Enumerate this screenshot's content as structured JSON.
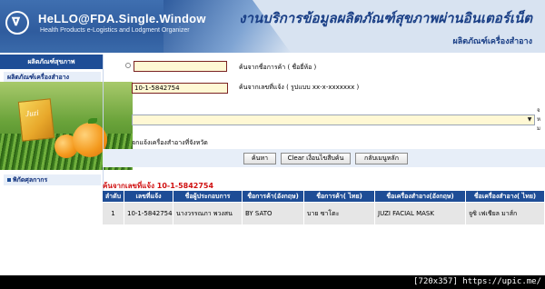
{
  "header": {
    "logo_mark": "𝛁",
    "brand": "HeLLO@FDA.Single.Window",
    "brand_sub": "Health Products e-Logistics and Lodgment Organizer",
    "title": "งานบริการข้อมูลผลิตภัณฑ์สุขภาพผ่านอินเตอร์เน็ต",
    "subtitle": "ผลิตภัณฑ์เครื่องสำอาง"
  },
  "sidebar": {
    "heading": "ผลิตภัณฑ์สุขภาพ",
    "items": [
      {
        "label": "ผลิตภัณฑ์เครื่องสำอาง"
      },
      {
        "label": "พิกัดศุลกากร"
      }
    ],
    "photo_brand": "Juzi"
  },
  "search": {
    "trade_name_value": "",
    "trade_name_hint": "ค้นจากชื่อการค้า ( ชื่อยี่ห้อ )",
    "notify_number_value": "10-1-5842754",
    "notify_number_hint": "ค้นจากเลขที่แจ้ง ( รูปแบบ xx-x-xxxxxxx )",
    "category_select_value": "",
    "right_letters": [
      "จ",
      "ห",
      "ม"
    ],
    "category_hint": "จกแจ้งเครื่องสำอางที่จังหวัด",
    "buttons": {
      "search": "ค้นหา",
      "clear": "Clear เงื่อนไขสืบค้น",
      "home": "กลับเมนูหลัก"
    }
  },
  "results": {
    "title": "ค้นจากเลขที่แจ้ง 10-1-5842754",
    "columns": [
      "ลำดับ",
      "เลขที่แจ้ง",
      "ชื่อผู้ประกอบการ",
      "ชื่อการค้า(อังกฤษ)",
      "ชื่อการค้า( ไทย)",
      "ชื่อเครื่องสำอาง(อังกฤษ)",
      "ชื่อเครื่องสำอาง( ไทย)"
    ],
    "rows": [
      [
        "1",
        "10-1-5842754",
        "นางวรรณภา พวงสน",
        "BY SATO",
        "บาย ซาโตะ",
        "JUZI FACIAL MASK",
        "จูซิ เฟเชียล มาส์ก"
      ]
    ]
  },
  "footer": {
    "text": "[720x357] https://upic.me/"
  },
  "colors": {
    "header_blue": "#2f5c9e",
    "nav_blue": "#1e4d96",
    "result_red": "#d01010",
    "input_yellow": "#fff8d4"
  }
}
